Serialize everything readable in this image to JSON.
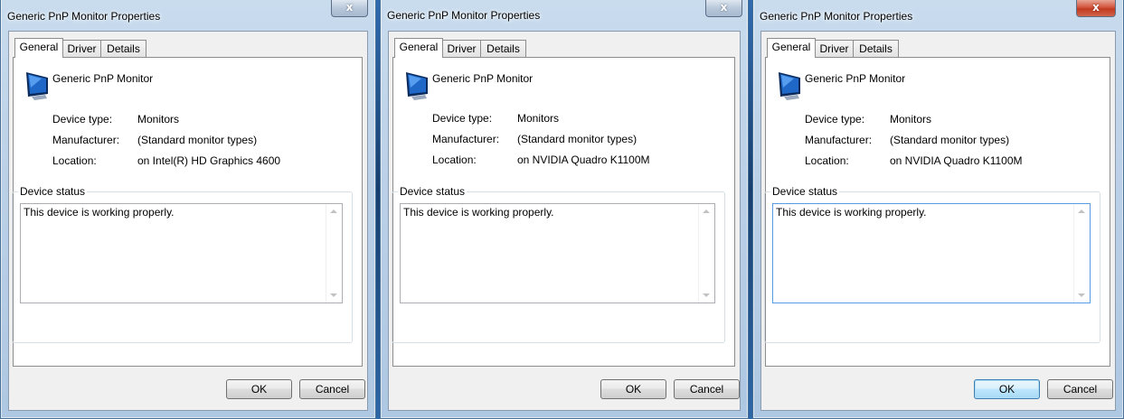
{
  "windows": [
    {
      "title": "Generic PnP Monitor Properties",
      "close_glyph": "x",
      "close_active": false,
      "tabs": [
        "General",
        "Driver",
        "Details"
      ],
      "device_name": "Generic PnP Monitor",
      "icon": "monitor-icon",
      "properties": [
        {
          "label": "Device type:",
          "value": "Monitors"
        },
        {
          "label": "Manufacturer:",
          "value": "(Standard monitor types)"
        },
        {
          "label": "Location:",
          "value": "on Intel(R) HD Graphics 4600"
        }
      ],
      "status_group_title": "Device status",
      "status_text": "This device is working properly.",
      "ok_label": "OK",
      "cancel_label": "Cancel"
    },
    {
      "title": "Generic PnP Monitor Properties",
      "close_glyph": "x",
      "close_active": false,
      "tabs": [
        "General",
        "Driver",
        "Details"
      ],
      "device_name": "Generic PnP Monitor",
      "icon": "monitor-icon",
      "properties": [
        {
          "label": "Device type:",
          "value": "Monitors"
        },
        {
          "label": "Manufacturer:",
          "value": "(Standard monitor types)"
        },
        {
          "label": "Location:",
          "value": "on NVIDIA Quadro K1100M"
        }
      ],
      "status_group_title": "Device status",
      "status_text": "This device is working properly.",
      "ok_label": "OK",
      "cancel_label": "Cancel"
    },
    {
      "title": "Generic PnP Monitor Properties",
      "close_glyph": "x",
      "close_active": true,
      "tabs": [
        "General",
        "Driver",
        "Details"
      ],
      "device_name": "Generic PnP Monitor",
      "icon": "monitor-icon",
      "properties": [
        {
          "label": "Device type:",
          "value": "Monitors"
        },
        {
          "label": "Manufacturer:",
          "value": "(Standard monitor types)"
        },
        {
          "label": "Location:",
          "value": "on NVIDIA Quadro K1100M"
        }
      ],
      "status_group_title": "Device status",
      "status_text": "This device is working properly.",
      "ok_label": "OK",
      "cancel_label": "Cancel"
    }
  ],
  "colors": {
    "close_active": "#c23b1f",
    "default_button_border": "#3c7fb1",
    "focus_border": "#569de5"
  }
}
